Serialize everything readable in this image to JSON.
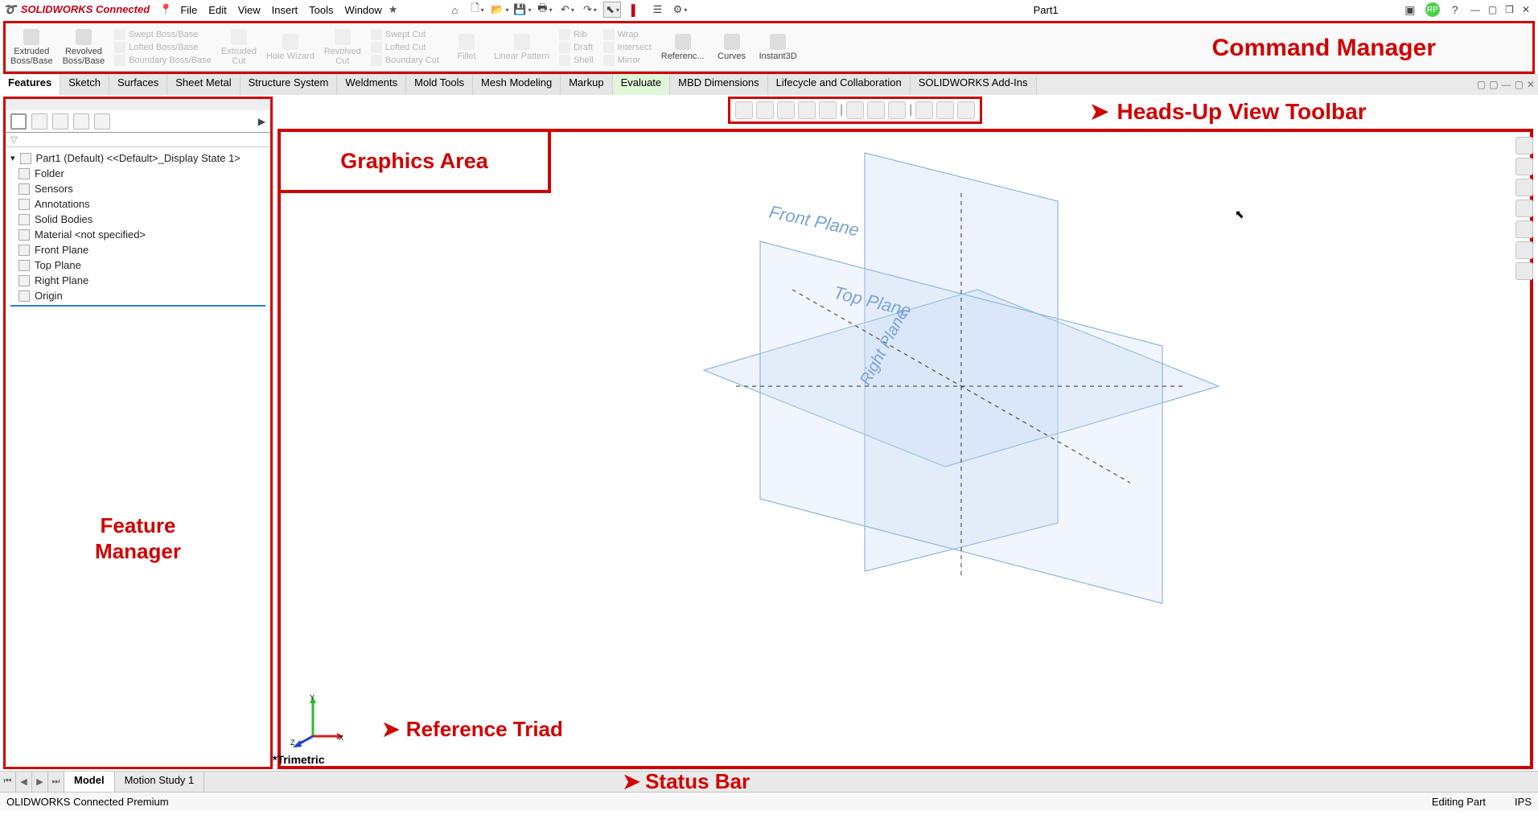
{
  "app": {
    "logo_text": "SOLIDWORKS Connected",
    "doc_title": "Part1"
  },
  "menu": {
    "items": [
      "File",
      "Edit",
      "View",
      "Insert",
      "Tools",
      "Window"
    ]
  },
  "titlebar_tool_icons": [
    "home-icon",
    "new-icon",
    "open-icon",
    "save-icon",
    "print-icon",
    "undo-icon",
    "redo-icon",
    "select-icon",
    "rebuild-icon",
    "options-panel-icon",
    "settings-icon"
  ],
  "command_manager": {
    "label": "Command Manager",
    "big_cmds": [
      {
        "label1": "Extruded",
        "label2": "Boss/Base",
        "enabled": true
      },
      {
        "label1": "Revolved",
        "label2": "Boss/Base",
        "enabled": true
      }
    ],
    "stack1": [
      "Swept Boss/Base",
      "Lofted Boss/Base",
      "Boundary Boss/Base"
    ],
    "big_cmds2": [
      {
        "label1": "Extruded",
        "label2": "Cut",
        "enabled": false
      },
      {
        "label1": "Hole Wizard",
        "label2": "",
        "enabled": false
      },
      {
        "label1": "Revolved",
        "label2": "Cut",
        "enabled": false
      }
    ],
    "stack2": [
      "Swept Cut",
      "Lofted Cut",
      "Boundary Cut"
    ],
    "big_cmds3": [
      {
        "label1": "Fillet",
        "label2": "",
        "enabled": false
      },
      {
        "label1": "Linear Pattern",
        "label2": "",
        "enabled": false
      }
    ],
    "stack3": [
      "Rib",
      "Draft",
      "Shell"
    ],
    "stack4": [
      "Wrap",
      "Intersect",
      "Mirror"
    ],
    "big_cmds4": [
      {
        "label1": "Referenc...",
        "label2": "",
        "enabled": true
      },
      {
        "label1": "Curves",
        "label2": "",
        "enabled": true
      },
      {
        "label1": "Instant3D",
        "label2": "",
        "enabled": true
      }
    ]
  },
  "cm_tabs": [
    "Features",
    "Sketch",
    "Surfaces",
    "Sheet Metal",
    "Structure System",
    "Weldments",
    "Mold Tools",
    "Mesh Modeling",
    "Markup",
    "Evaluate",
    "MBD Dimensions",
    "Lifecycle and Collaboration",
    "SOLIDWORKS Add-Ins"
  ],
  "cm_active_tab": "Features",
  "cm_highlight_tab": "Evaluate",
  "feature_manager": {
    "label_line1": "Feature",
    "label_line2": "Manager",
    "root": "Part1 (Default) <<Default>_Display State 1>",
    "nodes": [
      "Folder",
      "Sensors",
      "Annotations",
      "Solid Bodies",
      "Material <not specified>",
      "Front Plane",
      "Top Plane",
      "Right Plane",
      "Origin"
    ]
  },
  "graphics_area": {
    "label": "Graphics Area",
    "view_note": "*Trimetric",
    "plane_front": "Front Plane",
    "plane_top": "Top Plane",
    "plane_right": "Right Plane",
    "triad_label": "Reference Triad",
    "triad_axis_x": "X",
    "triad_axis_y": "Y",
    "triad_axis_z": "Z"
  },
  "heads_up": {
    "label": "Heads-Up View Toolbar",
    "icons": [
      "zoom-fit-icon",
      "zoom-area-icon",
      "prev-view-icon",
      "section-icon",
      "view-orient-icon",
      "display-style-icon",
      "hide-show-icon",
      "edit-appearance-icon",
      "apply-scene-icon",
      "view-settings-icon",
      "screen-icon"
    ]
  },
  "resource_strip_icons": [
    "sw-resources-icon",
    "design-library-icon",
    "file-explorer-icon",
    "view-palette-icon",
    "appearances-icon",
    "custom-props-icon",
    "forum-icon"
  ],
  "bottom_tabs": {
    "model": "Model",
    "motion": "Motion Study 1",
    "status_label": "Status Bar"
  },
  "statusbar": {
    "left": "OLIDWORKS Connected Premium",
    "mode": "Editing Part",
    "units": "IPS"
  }
}
